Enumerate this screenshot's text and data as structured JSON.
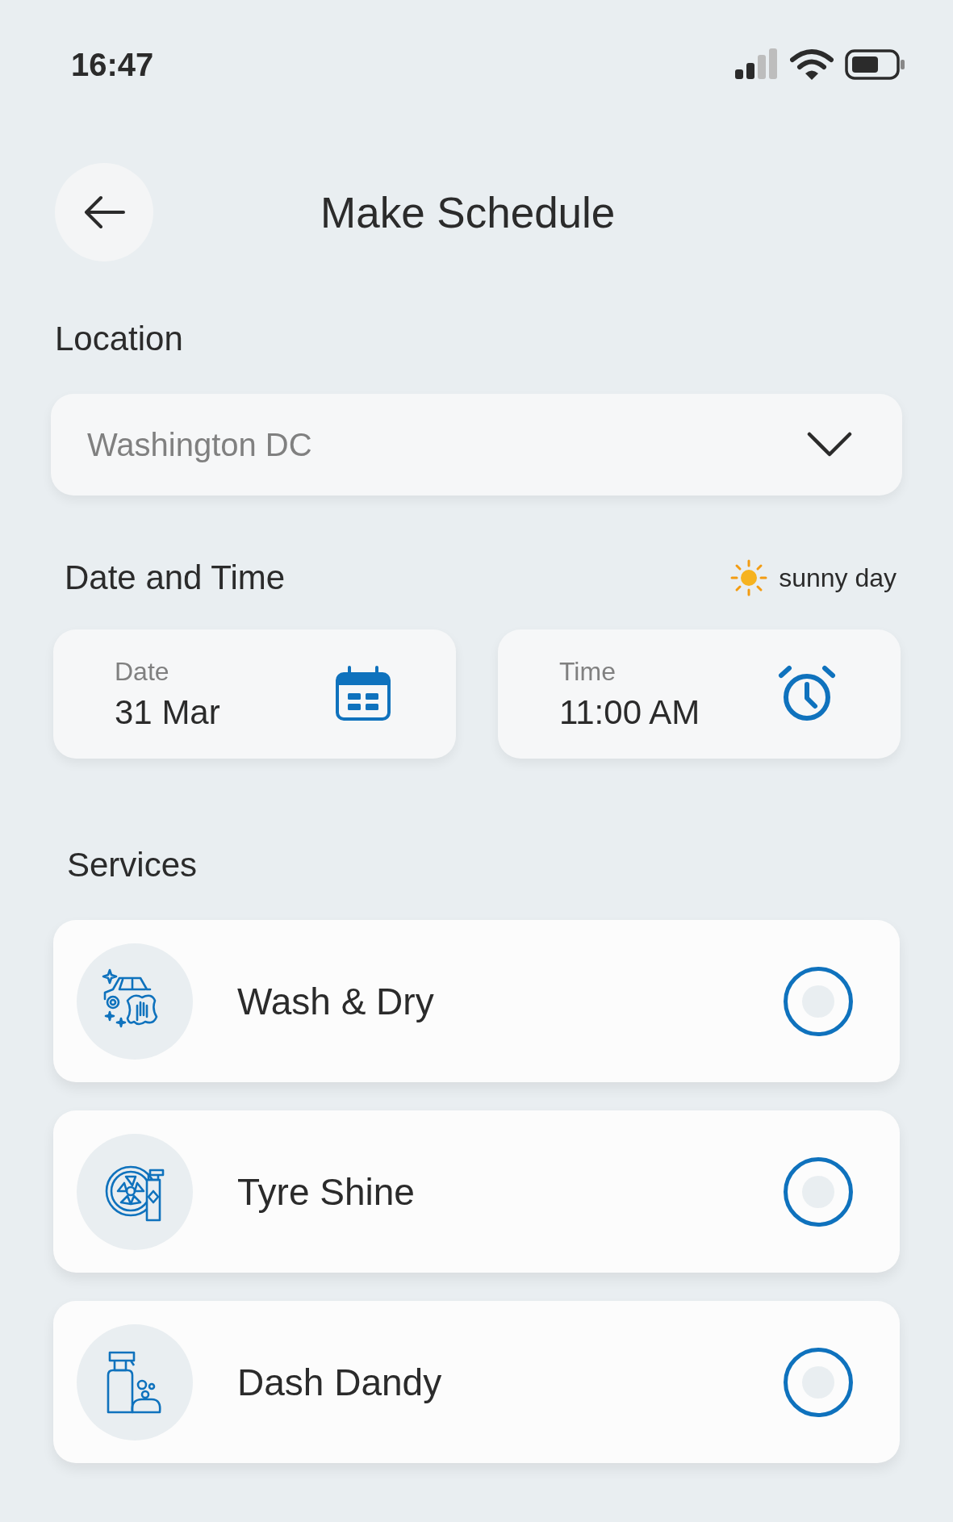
{
  "status_bar": {
    "time": "16:47"
  },
  "header": {
    "title": "Make Schedule"
  },
  "location": {
    "label": "Location",
    "value": "Washington DC"
  },
  "date_time": {
    "label": "Date and Time",
    "weather": "sunny day",
    "date": {
      "label": "Date",
      "value": "31 Mar"
    },
    "time": {
      "label": "Time",
      "value": "11:00 AM"
    }
  },
  "services": {
    "label": "Services",
    "items": [
      {
        "kind": "wash",
        "name": "Wash & Dry",
        "selected": false
      },
      {
        "kind": "tyre",
        "name": "Tyre Shine",
        "selected": false
      },
      {
        "kind": "dash",
        "name": "Dash Dandy",
        "selected": false
      }
    ]
  }
}
